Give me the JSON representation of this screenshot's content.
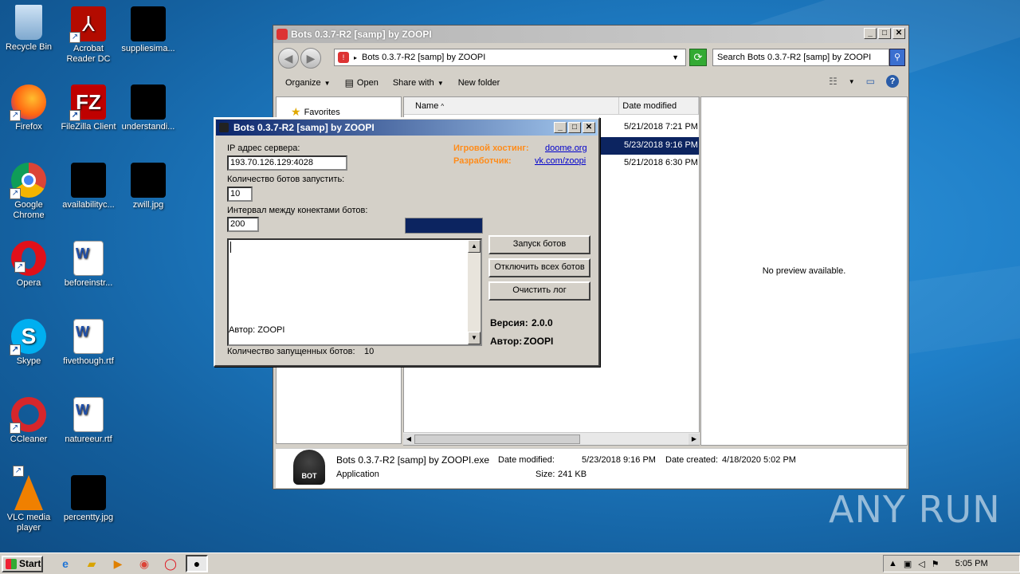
{
  "desktop": {
    "icons": [
      {
        "label": "Recycle Bin"
      },
      {
        "label": "Acrobat Reader DC"
      },
      {
        "label": "suppliesima..."
      },
      {
        "label": "Firefox"
      },
      {
        "label": "FileZilla Client"
      },
      {
        "label": "understandi..."
      },
      {
        "label": "Google Chrome"
      },
      {
        "label": "availabilityc..."
      },
      {
        "label": "zwill.jpg"
      },
      {
        "label": "Opera"
      },
      {
        "label": "beforeinstr..."
      },
      {
        "label": "Skype"
      },
      {
        "label": "fivethough.rtf"
      },
      {
        "label": "CCleaner"
      },
      {
        "label": "natureeur.rtf"
      },
      {
        "label": "VLC media player"
      },
      {
        "label": "percentty.jpg"
      }
    ]
  },
  "explorer": {
    "title": "Bots 0.3.7-R2 [samp] by ZOOPI",
    "address": "Bots 0.3.7-R2 [samp] by ZOOPI",
    "search_placeholder": "Search Bots 0.3.7-R2 [samp] by ZOOPI",
    "toolbar": {
      "organize": "Organize",
      "open": "Open",
      "share_with": "Share with",
      "new_folder": "New folder"
    },
    "nav": {
      "favorites": "Favorites"
    },
    "columns": {
      "name": "Name",
      "date_modified": "Date modified"
    },
    "rows": [
      {
        "date": "5/21/2018 7:21 PM"
      },
      {
        "date": "5/23/2018 9:16 PM"
      },
      {
        "date": "5/21/2018 6:30 PM"
      }
    ],
    "preview_text": "No preview available.",
    "details": {
      "filename": "Bots 0.3.7-R2 [samp] by ZOOPI.exe",
      "type": "Application",
      "date_modified_label": "Date modified:",
      "date_modified": "5/23/2018 9:16 PM",
      "size_label": "Size:",
      "size": "241 KB",
      "date_created_label": "Date created:",
      "date_created": "4/18/2020 5:02 PM",
      "icon_text": "BOT"
    }
  },
  "botwin": {
    "title": "Bots 0.3.7-R2 [samp] by ZOOPI",
    "ip_label": "IP адрес сервера:",
    "ip_value": "193.70.126.129:4028",
    "count_label": "Количество ботов запустить:",
    "count_value": "10",
    "interval_label": "Интервал между конектами ботов:",
    "interval_value": "200",
    "hosting_label": "Игровой хостинг:",
    "hosting_link": "doome.org",
    "dev_label": "Разработчик:",
    "dev_link": "vk.com/zoopi",
    "log_author": "Автор: ZOOPI",
    "btn_start": "Запуск ботов",
    "btn_disconnect": "Отключить всех ботов",
    "btn_clear": "Очистить лог",
    "version_label": "Версия:",
    "version_value": "2.0.0",
    "author_label": "Автор:",
    "author_value": "ZOOPI",
    "started_label": "Количество запущенных ботов:",
    "started_value": "10"
  },
  "watermark": "ANY RUN",
  "taskbar": {
    "start": "Start",
    "time": "5:05 PM"
  }
}
